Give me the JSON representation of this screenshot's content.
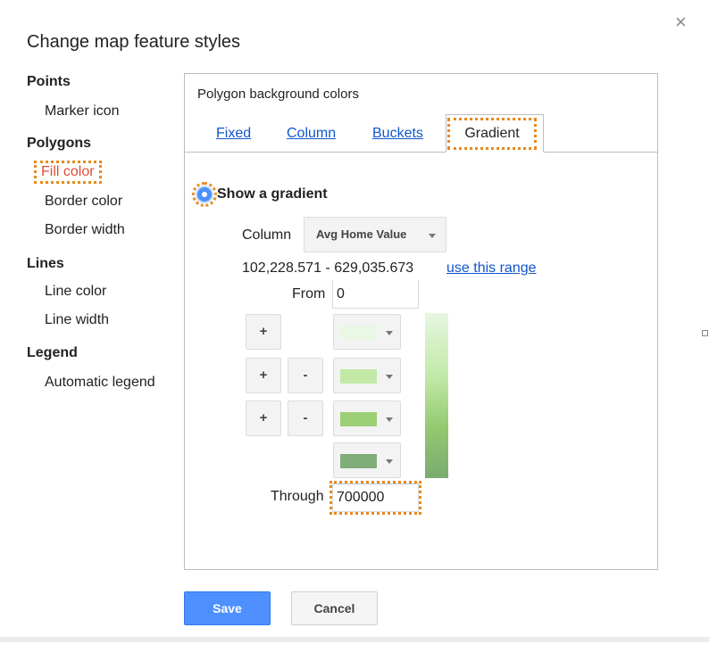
{
  "dialog": {
    "title": "Change map feature styles",
    "close_glyph": "×"
  },
  "sidebar": {
    "points": {
      "heading": "Points",
      "items": [
        "Marker icon"
      ]
    },
    "polygons": {
      "heading": "Polygons",
      "items": [
        "Fill color",
        "Border color",
        "Border width"
      ]
    },
    "lines": {
      "heading": "Lines",
      "items": [
        "Line color",
        "Line width"
      ]
    },
    "legend": {
      "heading": "Legend",
      "items": [
        "Automatic legend"
      ]
    },
    "active_item": "Fill color"
  },
  "panel": {
    "title": "Polygon background colors",
    "tabs": [
      {
        "label": "Fixed"
      },
      {
        "label": "Column"
      },
      {
        "label": "Buckets"
      },
      {
        "label": "Gradient"
      }
    ],
    "active_tab": "Gradient"
  },
  "gradient": {
    "radio_label": "Show a gradient",
    "column_label": "Column",
    "column_value": "Avg Home Value",
    "range_text": "102,228.571 - 629,035.673",
    "range_link": "use this range",
    "from_label": "From",
    "from_value": "0",
    "through_label": "Through",
    "through_value": "700000",
    "add_glyph": "+",
    "remove_glyph": "-",
    "swatches": [
      "#e9f7e4",
      "#c2eaa6",
      "#9ccf76",
      "#80ad78"
    ]
  },
  "buttons": {
    "save": "Save",
    "cancel": "Cancel"
  },
  "colors": {
    "accent": "#4d90fe",
    "link": "#1155cc",
    "focus": "#e8891d",
    "active_text": "#dd4b39"
  },
  "icons": {
    "close": "close-icon",
    "dropdown": "chevron-down-icon",
    "radio": "radio-selected-icon"
  }
}
